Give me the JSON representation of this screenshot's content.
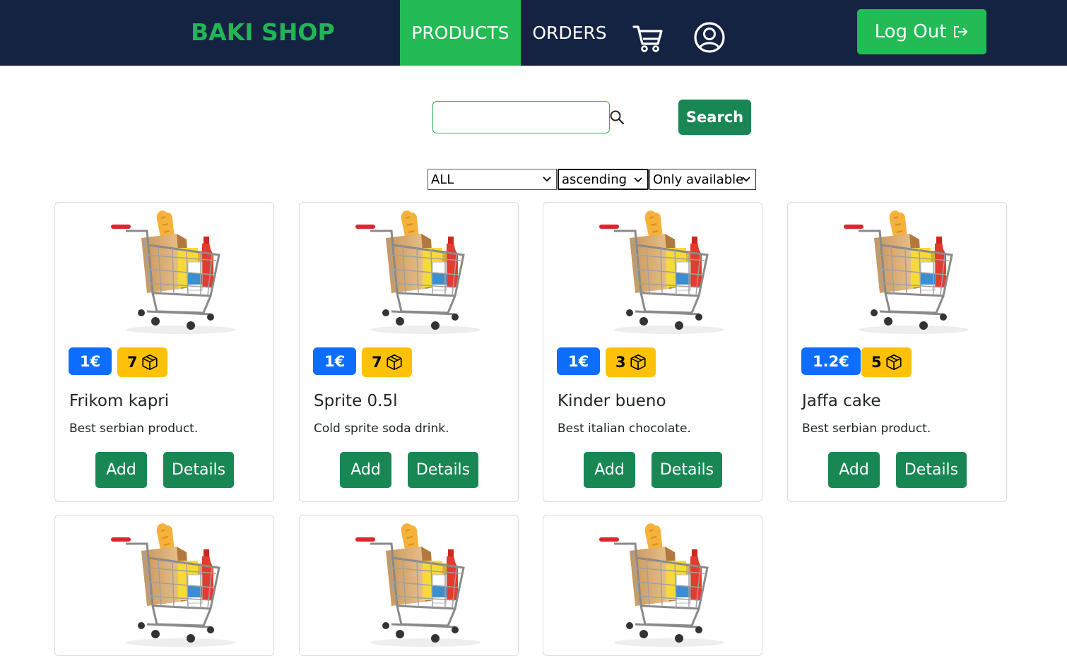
{
  "brand": "BAKI SHOP",
  "nav": {
    "products": "PRODUCTS",
    "orders": "ORDERS",
    "cart_icon": "shopping-cart-icon",
    "user_icon": "user-circle-icon",
    "logout": "Log Out",
    "logout_icon": "box-arrow-right-icon"
  },
  "colors": {
    "navbar_bg": "#152342",
    "brand_green": "#22b455",
    "active_nav": "#22bb55",
    "button_green": "#198754",
    "price_badge": "#0d6efd",
    "stock_badge": "#ffc107"
  },
  "search": {
    "value": "",
    "placeholder": "",
    "button": "Search"
  },
  "filters": {
    "category": "ALL",
    "order": "ascending",
    "availability": "Only available"
  },
  "products": [
    {
      "price": "1€",
      "stock": "7",
      "name": "Frikom kapri",
      "description": "Best serbian product.",
      "add": "Add",
      "details": "Details"
    },
    {
      "price": "1€",
      "stock": "7",
      "name": "Sprite 0.5l",
      "description": "Cold sprite soda drink.",
      "add": "Add",
      "details": "Details"
    },
    {
      "price": "1€",
      "stock": "3",
      "name": "Kinder bueno",
      "description": "Best italian chocolate.",
      "add": "Add",
      "details": "Details"
    },
    {
      "price": "1.2€",
      "stock": "5",
      "name": "Jaffa cake",
      "description": "Best serbian product.",
      "add": "Add",
      "details": "Details"
    },
    {
      "price": "",
      "stock": "",
      "name": "",
      "description": "",
      "add": "",
      "details": ""
    },
    {
      "price": "",
      "stock": "",
      "name": "",
      "description": "",
      "add": "",
      "details": ""
    },
    {
      "price": "",
      "stock": "",
      "name": "",
      "description": "",
      "add": "",
      "details": ""
    }
  ]
}
